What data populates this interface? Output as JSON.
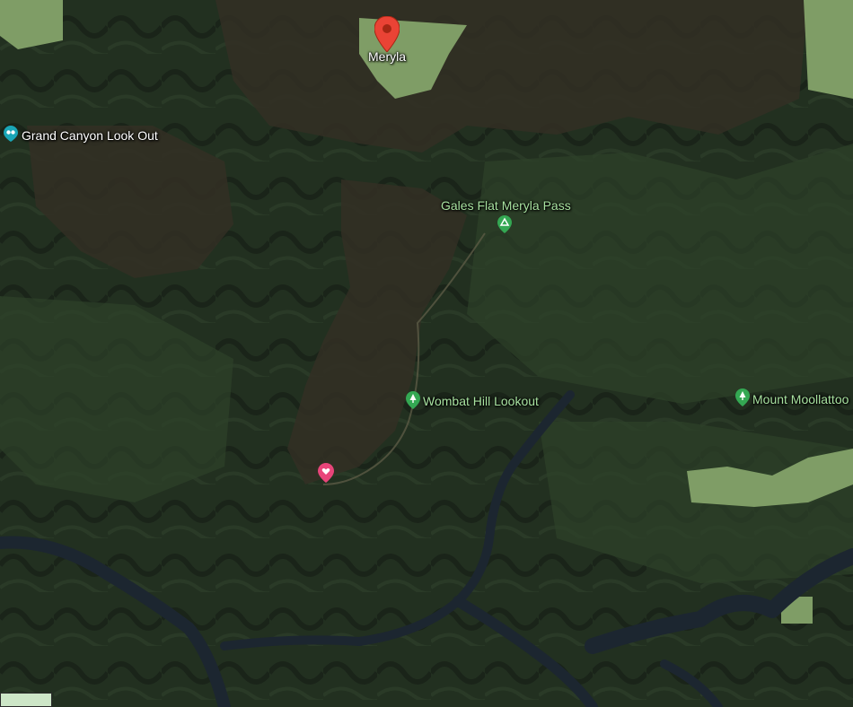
{
  "map": {
    "type": "satellite",
    "places": {
      "meryla": "Meryla",
      "grand_canyon": "Grand Canyon Look Out",
      "gales_flat": "Gales Flat Meryla Pass",
      "wombat_hill": "Wombat Hill Lookout",
      "mount_moollattoo": "Mount Moollattoo"
    },
    "icons": {
      "meryla": "red-location-pin-icon",
      "grand_canyon": "viewpoint-icon",
      "gales_flat": "campground-icon",
      "wombat_hill": "park-tree-icon",
      "mount_moollattoo": "park-tree-icon",
      "heart": "saved-place-heart-icon"
    },
    "colors": {
      "forest_dark": "#1f2a1d",
      "forest_mid": "#2b3a28",
      "ridge": "#3a3326",
      "river": "#1a2330",
      "clearing": "#8fae74",
      "pin_red": "#ea4335",
      "heart_pink": "#e8457a",
      "park_green": "#34a853",
      "viewpoint_teal": "#1aa6b7"
    }
  }
}
